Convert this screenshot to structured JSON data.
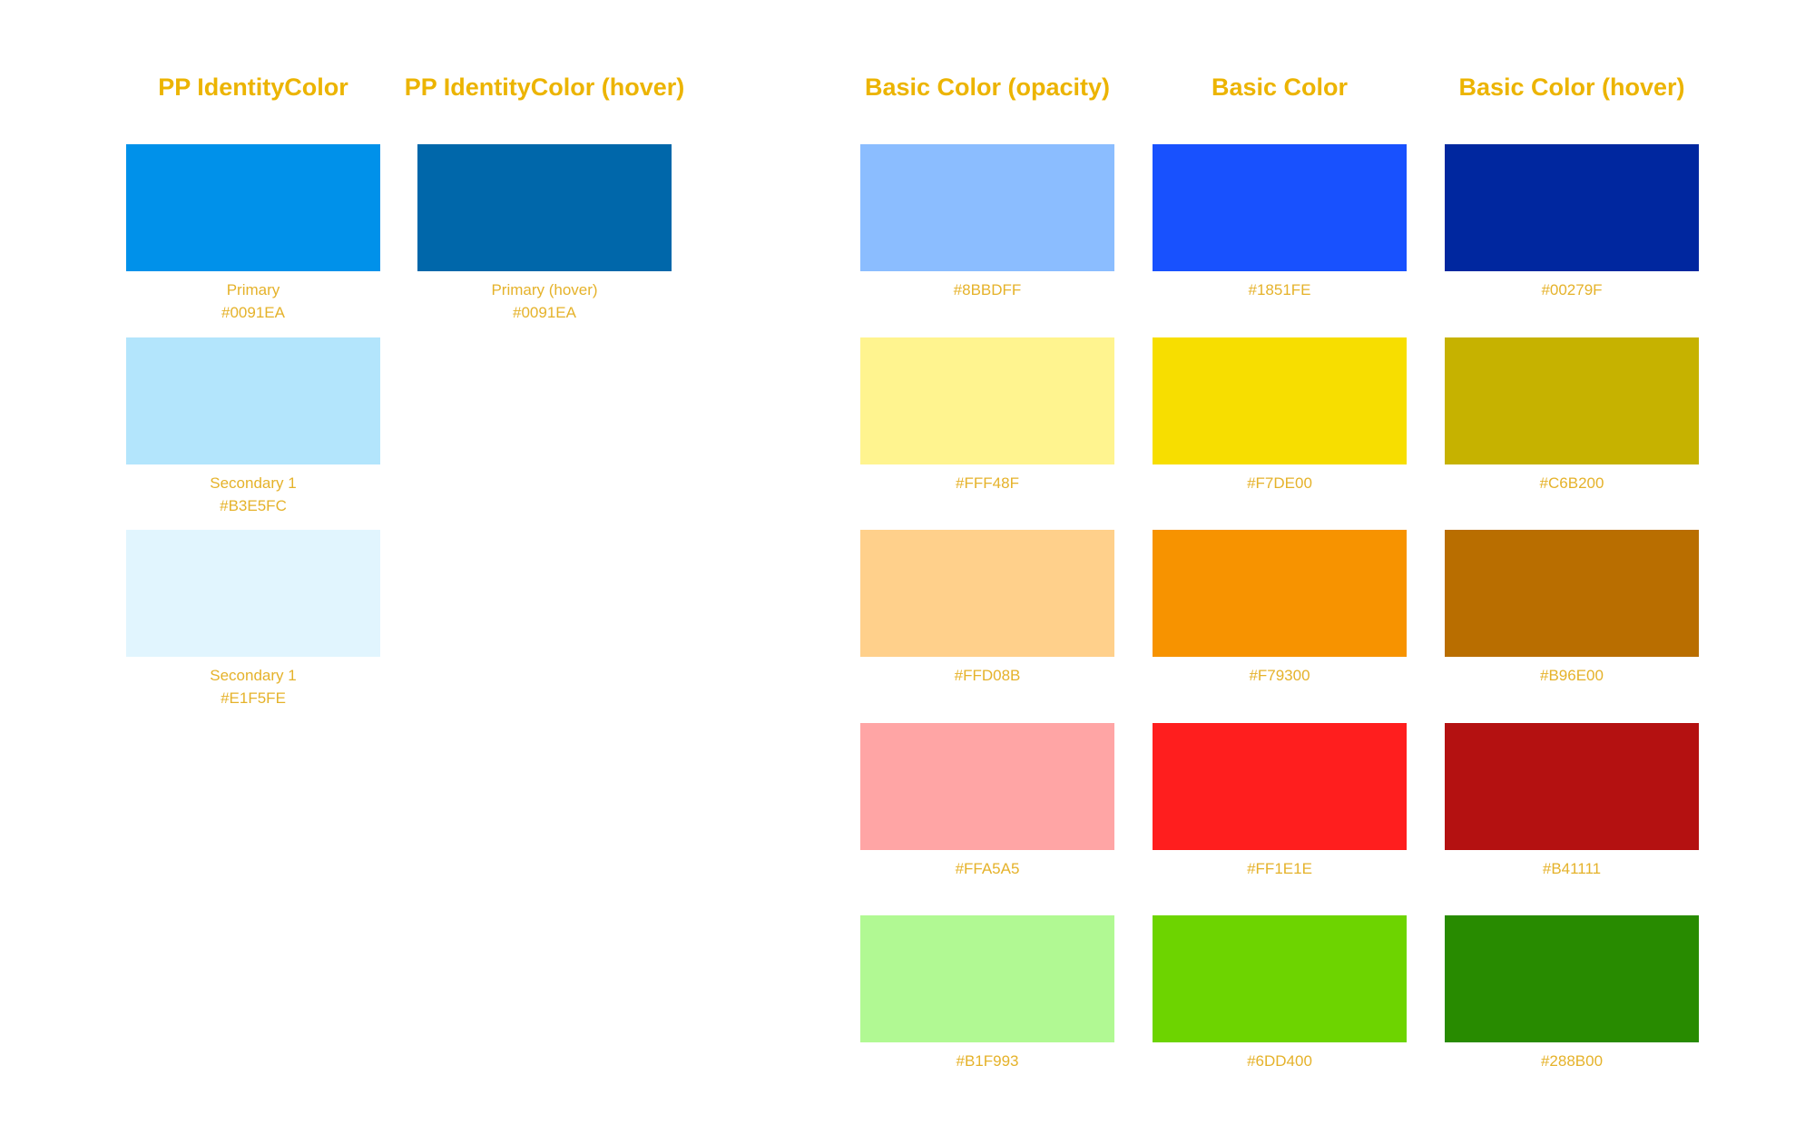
{
  "columns": [
    {
      "id": "pp-identity",
      "title": "PP IdentityColor",
      "swatches": [
        {
          "label": "Primary",
          "hex": "#0091EA",
          "color": "#0091EA"
        },
        {
          "label": "Secondary 1",
          "hex": "#B3E5FC",
          "color": "#B3E5FC"
        },
        {
          "label": "Secondary 1",
          "hex": "#E1F5FE",
          "color": "#E1F5FE"
        }
      ]
    },
    {
      "id": "pp-identity-hover",
      "title": "PP IdentityColor (hover)",
      "swatches": [
        {
          "label": "Primary (hover)",
          "hex": "#0091EA",
          "color": "#0067AA"
        }
      ]
    },
    {
      "id": "basic-opacity",
      "title": "Basic Color (opacity)",
      "swatches": [
        {
          "label": "",
          "hex": "#8BBDFF",
          "color": "#8BBDFF"
        },
        {
          "label": "",
          "hex": "#FFF48F",
          "color": "#FFF48F"
        },
        {
          "label": "",
          "hex": "#FFD08B",
          "color": "#FFD08B"
        },
        {
          "label": "",
          "hex": "#FFA5A5",
          "color": "#FFA5A5"
        },
        {
          "label": "",
          "hex": "#B1F993",
          "color": "#B1F993"
        }
      ]
    },
    {
      "id": "basic",
      "title": "Basic Color",
      "swatches": [
        {
          "label": "",
          "hex": "#1851FE",
          "color": "#1851FE"
        },
        {
          "label": "",
          "hex": "#F7DE00",
          "color": "#F7DE00"
        },
        {
          "label": "",
          "hex": "#F79300",
          "color": "#F79300"
        },
        {
          "label": "",
          "hex": "#FF1E1E",
          "color": "#FF1E1E"
        },
        {
          "label": "",
          "hex": "#6DD400",
          "color": "#6DD400"
        }
      ]
    },
    {
      "id": "basic-hover",
      "title": "Basic Color (hover)",
      "swatches": [
        {
          "label": "",
          "hex": "#00279F",
          "color": "#00279F"
        },
        {
          "label": "",
          "hex": "#C6B200",
          "color": "#C6B200"
        },
        {
          "label": "",
          "hex": "#B96E00",
          "color": "#B96E00"
        },
        {
          "label": "",
          "hex": "#B41111",
          "color": "#B41111"
        },
        {
          "label": "",
          "hex": "#288B00",
          "color": "#288B00"
        }
      ]
    }
  ]
}
